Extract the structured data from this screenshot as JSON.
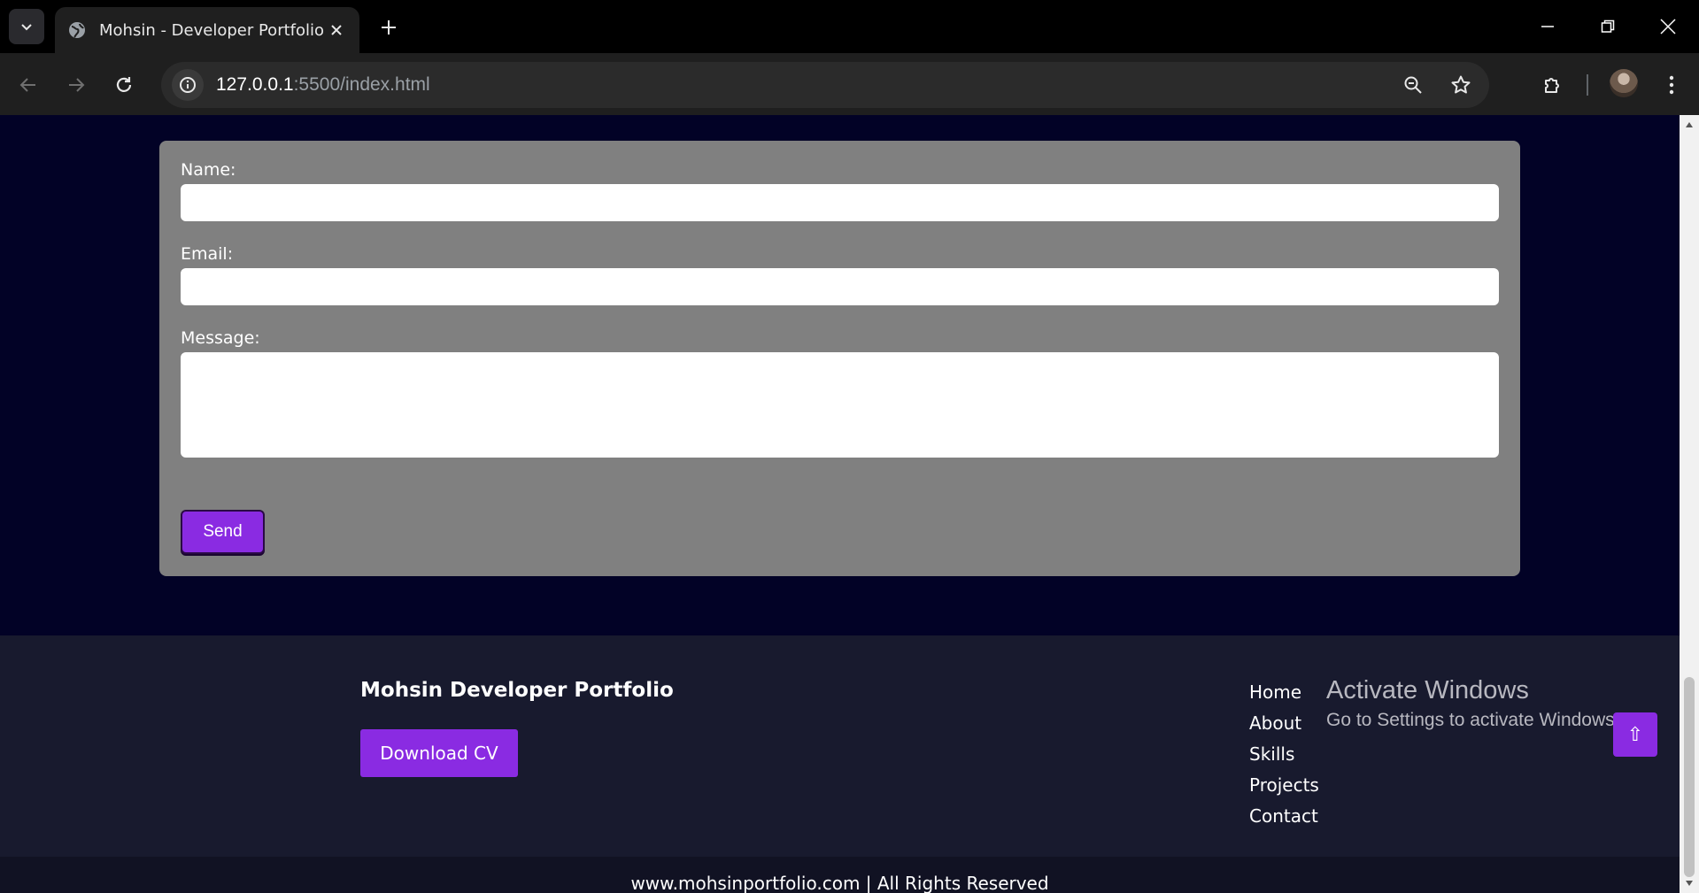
{
  "browser": {
    "tab_title": "Mohsin - Developer Portfolio",
    "url_host": "127.0.0.1",
    "url_path": ":5500/index.html"
  },
  "form": {
    "name_label": "Name:",
    "email_label": "Email:",
    "message_label": "Message:",
    "name_value": "",
    "email_value": "",
    "message_value": "",
    "send_label": "Send"
  },
  "footer": {
    "brand": "Mohsin Developer Portfolio",
    "download_label": "Download CV",
    "links": [
      "Home",
      "About",
      "Skills",
      "Projects",
      "Contact"
    ],
    "copyright": "www.mohsinportfolio.com | All Rights Reserved"
  },
  "watermark": {
    "title": "Activate Windows",
    "subtitle": "Go to Settings to activate Windows."
  },
  "back_to_top_glyph": "⇧",
  "colors": {
    "accent": "#8a2be2",
    "page_bg": "#020226",
    "form_bg": "#808080",
    "footer_bg": "#181a2e"
  }
}
